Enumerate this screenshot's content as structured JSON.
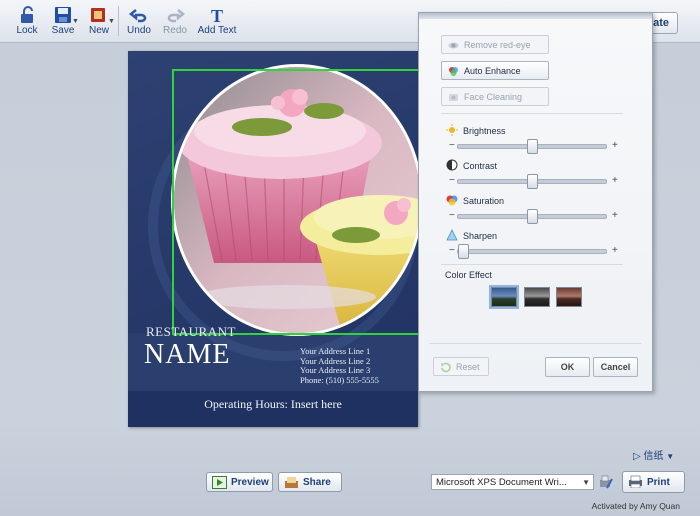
{
  "toolbar": {
    "lock": "Lock",
    "save": "Save",
    "new": "New",
    "undo": "Undo",
    "redo": "Redo",
    "add_text": "Add Text",
    "template_btn": "plate"
  },
  "document": {
    "restaurant": "RESTAURANT",
    "name": "NAME",
    "address_lines": [
      "Your Address Line 1",
      "Your Address Line 2",
      "Your Address Line 3",
      "Phone: (510) 555-5555"
    ],
    "hours": "Operating Hours: Insert here"
  },
  "panel": {
    "remove_red_eye": "Remove red-eye",
    "auto_enhance": "Auto Enhance",
    "face_cleaning": "Face Cleaning",
    "sliders": [
      {
        "label": "Brightness",
        "value": 0.5
      },
      {
        "label": "Contrast",
        "value": 0.5
      },
      {
        "label": "Saturation",
        "value": 0.5
      },
      {
        "label": "Sharpen",
        "value": 0.0
      }
    ],
    "minus": "−",
    "plus": "+",
    "color_effect": "Color Effect",
    "reset": "Reset",
    "ok": "OK",
    "cancel": "Cancel"
  },
  "bottom": {
    "preview": "Preview",
    "share": "Share",
    "printer": "Microsoft XPS Document Wri...",
    "print": "Print",
    "paper": "信纸",
    "activated": "Activated by Amy Quan"
  },
  "colors": {
    "accent": "#1d3f7a",
    "selection": "#2fd33b",
    "doc_bg": "#2b3f6e"
  }
}
